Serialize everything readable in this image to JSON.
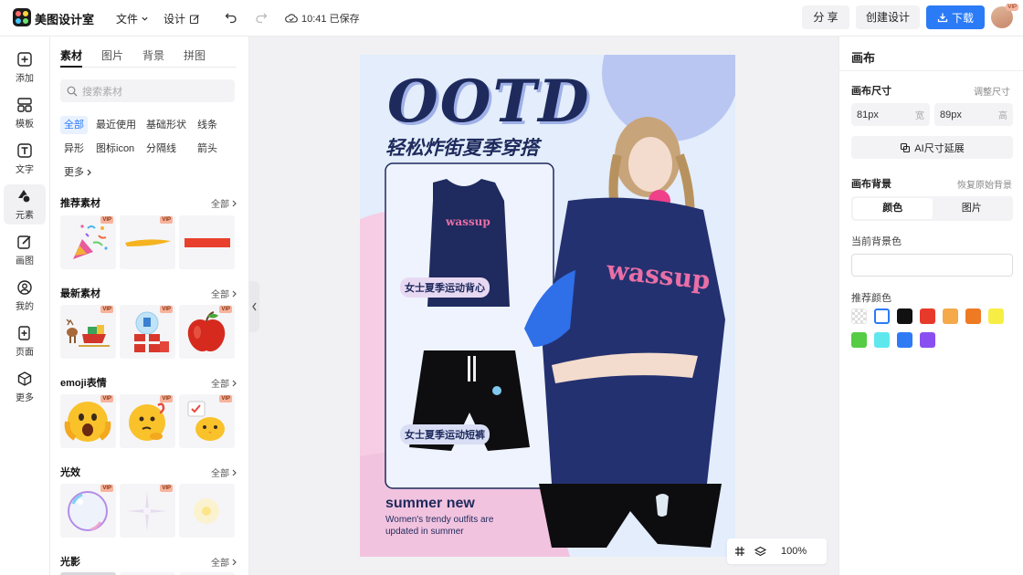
{
  "app": {
    "name": "美图设计室",
    "menu_file": "文件",
    "menu_design": "设计",
    "save_time": "10:41 已保存"
  },
  "toolbar": {
    "share": "分 享",
    "create": "创建设计",
    "download": "下载",
    "avatar_badge": "VIP"
  },
  "rail": [
    {
      "label": "添加",
      "icon": "plus-square-icon"
    },
    {
      "label": "模板",
      "icon": "template-icon"
    },
    {
      "label": "文字",
      "icon": "text-icon"
    },
    {
      "label": "元素",
      "icon": "shapes-icon",
      "active": true
    },
    {
      "label": "画图",
      "icon": "pencil-icon"
    },
    {
      "label": "我的",
      "icon": "user-icon"
    },
    {
      "label": "页面",
      "icon": "page-add-icon"
    },
    {
      "label": "更多",
      "icon": "cube-icon"
    }
  ],
  "panel": {
    "tabs": [
      "素材",
      "图片",
      "背景",
      "拼图"
    ],
    "search_placeholder": "搜索素材",
    "chips": [
      "全部",
      "最近使用",
      "基础形状",
      "线条",
      "异形",
      "图标icon",
      "分隔线",
      "箭头",
      "更多"
    ],
    "all_label": "全部",
    "vip_label": "VIP",
    "sections": [
      "推荐素材",
      "最新素材",
      "emoji表情",
      "光效",
      "光影"
    ]
  },
  "poster": {
    "headline": "OOTD",
    "subtitle": "轻松炸街夏季穿搭",
    "item1_label": "女士夏季运动背心",
    "item2_label": "女士夏季运动短裤",
    "tank_print": "wassup",
    "model_print": "wassup",
    "footer_title": "summer new",
    "footer_line1": "Women's trendy outfits are",
    "footer_line2": "updated in summer"
  },
  "zoom": {
    "level": "100%"
  },
  "right": {
    "title": "画布",
    "size_label": "画布尺寸",
    "size_link": "调整尺寸",
    "width_value": "81px",
    "width_unit": "宽",
    "height_value": "89px",
    "height_unit": "高",
    "ai_button": "AI尺寸延展",
    "bg_label": "画布背景",
    "bg_link": "恢复原始背景",
    "seg_color": "颜色",
    "seg_image": "图片",
    "current_bg_label": "当前背景色",
    "recommend_label": "推荐颜色",
    "swatches": [
      "transparent",
      "#ffffff",
      "#111111",
      "#e83a2b",
      "#f5a94a",
      "#ef7a24",
      "#f7ee45",
      "#55cc44",
      "#5ee8ee",
      "#2f7bf5",
      "#8a4ff0"
    ]
  }
}
